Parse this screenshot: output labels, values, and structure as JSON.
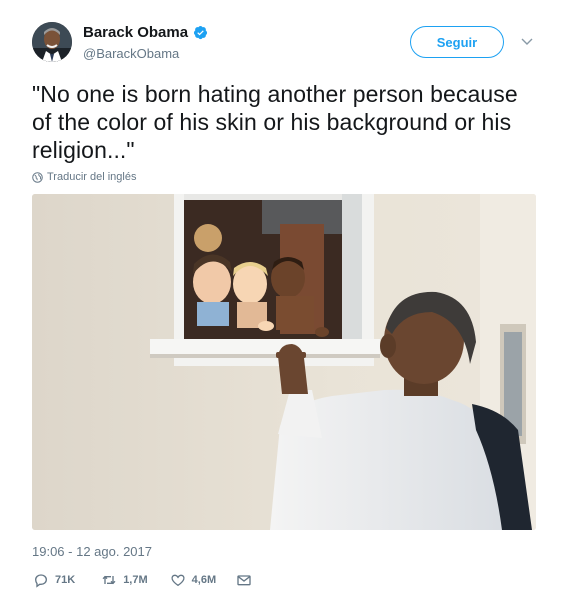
{
  "author": {
    "display_name": "Barack Obama",
    "handle": "@BarackObama",
    "verified": true,
    "avatar_icon": "avatar-photo"
  },
  "header": {
    "follow_label": "Seguir",
    "menu_icon": "chevron-down-icon"
  },
  "tweet": {
    "text": "\"No one is born hating another person because of the color of his skin or his background or his religion...\"",
    "translate_label": "Traducir del inglés",
    "timestamp": "19:06 - 12 ago. 2017"
  },
  "actions": {
    "replies": "71K",
    "retweets": "1,7M",
    "likes": "4,6M"
  },
  "colors": {
    "accent": "#1da1f2",
    "muted": "#657786",
    "text": "#14171a"
  }
}
